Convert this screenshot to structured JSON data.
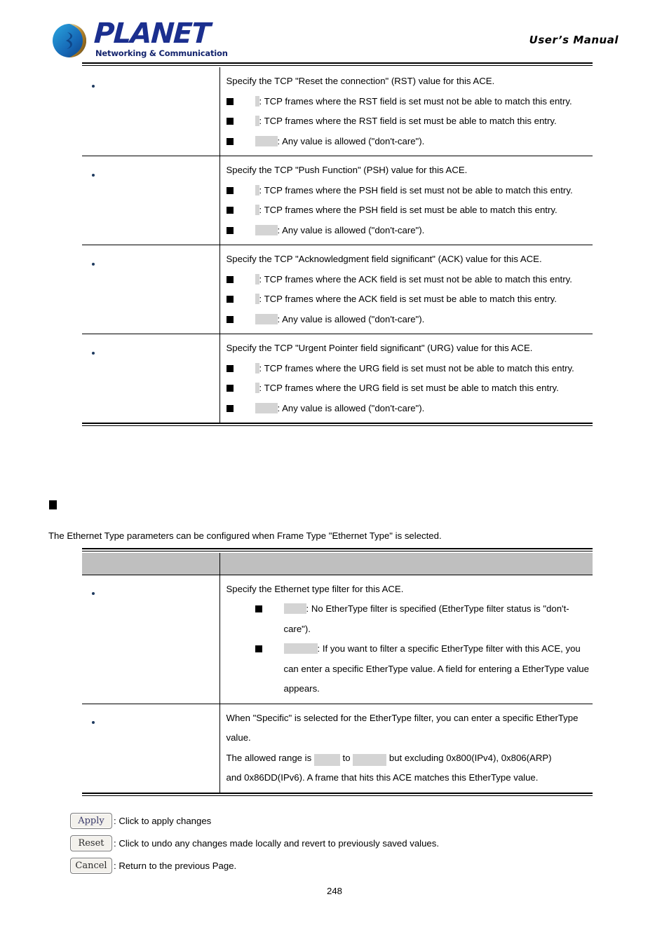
{
  "header": {
    "brand_name": "PLANET",
    "brand_tagline": "Networking & Communication",
    "manual_label": "User’s Manual"
  },
  "tcp_flags_table": {
    "rows": [
      {
        "label": "",
        "intro": "Specify the TCP \"Reset the connection\" (RST) value for this ACE.",
        "options": [
          {
            "value": "",
            "chip": "chip-xs",
            "desc": ": TCP frames where the RST field is set must not be able to match this entry."
          },
          {
            "value": "",
            "chip": "chip-xs",
            "desc": ": TCP frames where the RST field is set must be able to match this entry."
          },
          {
            "value": "",
            "chip": "chip-m",
            "desc": ": Any value is allowed (\"don't-care\")."
          }
        ]
      },
      {
        "label": "",
        "intro": "Specify the TCP \"Push Function\" (PSH) value for this ACE.",
        "options": [
          {
            "value": "",
            "chip": "chip-xs",
            "desc": ": TCP frames where the PSH field is set must not be able to match this entry."
          },
          {
            "value": "",
            "chip": "chip-xs",
            "desc": ": TCP frames where the PSH field is set must be able to match this entry."
          },
          {
            "value": "",
            "chip": "chip-m",
            "desc": ": Any value is allowed (\"don't-care\")."
          }
        ]
      },
      {
        "label": "",
        "intro": "Specify the TCP \"Acknowledgment field significant\" (ACK) value for this ACE.",
        "options": [
          {
            "value": "",
            "chip": "chip-xs",
            "desc": ": TCP frames where the ACK field is set must not be able to match this entry."
          },
          {
            "value": "",
            "chip": "chip-xs",
            "desc": ": TCP frames where the ACK field is set must be able to match this entry."
          },
          {
            "value": "",
            "chip": "chip-m",
            "desc": ": Any value is allowed (\"don't-care\")."
          }
        ]
      },
      {
        "label": "",
        "intro": "Specify the TCP \"Urgent Pointer field significant\" (URG) value for this ACE.",
        "options": [
          {
            "value": "",
            "chip": "chip-xs",
            "desc": ": TCP frames where the URG field is set must not be able to match this entry."
          },
          {
            "value": "",
            "chip": "chip-xs",
            "desc": ": TCP frames where the URG field is set must be able to match this entry."
          },
          {
            "value": "",
            "chip": "chip-m",
            "desc": ": Any value is allowed (\"don't-care\")."
          }
        ]
      }
    ]
  },
  "ethernet_section": {
    "heading": "",
    "intro": "The Ethernet Type parameters can be configured when Frame Type \"Ethernet Type\" is selected.",
    "table": {
      "header": {
        "col1": "",
        "col2": ""
      },
      "rows": [
        {
          "label": "",
          "intro": "Specify the Ethernet type filter for this ACE.",
          "options": [
            {
              "value": "",
              "chip": "chip-m",
              "desc": ": No EtherType filter is specified (EtherType filter status is \"don't-care\")."
            },
            {
              "value": "",
              "chip": "chip-l",
              "desc": ": If you want to filter a specific EtherType filter with this ACE, you can enter a specific EtherType value. A field for entering a EtherType value appears."
            }
          ]
        },
        {
          "label": "",
          "lines": [
            "When \"Specific\" is selected for the EtherType filter, you can enter a specific EtherType value.",
            "range_line",
            "and 0x86DD(IPv6). A frame that hits this ACE matches this EtherType value."
          ],
          "range": {
            "prefix": "The allowed range is",
            "min": "",
            "joiner": "to",
            "max": "",
            "suffix": "but excluding 0x800(IPv4), 0x806(ARP)"
          }
        }
      ]
    }
  },
  "buttons": [
    {
      "label": "Apply",
      "desc": ": Click to apply changes"
    },
    {
      "label": "Reset",
      "desc": ": Click to undo any changes made locally and revert to previously saved values."
    },
    {
      "label": "Cancel",
      "desc": ": Return to the previous Page."
    }
  ],
  "footer": {
    "page_number": "248"
  },
  "colors": {
    "brand_blue": "#1b2f8f",
    "chip_grey": "#d4d4d4",
    "header_band": "#bfbfbf",
    "bullet": "#1f3a5f"
  }
}
